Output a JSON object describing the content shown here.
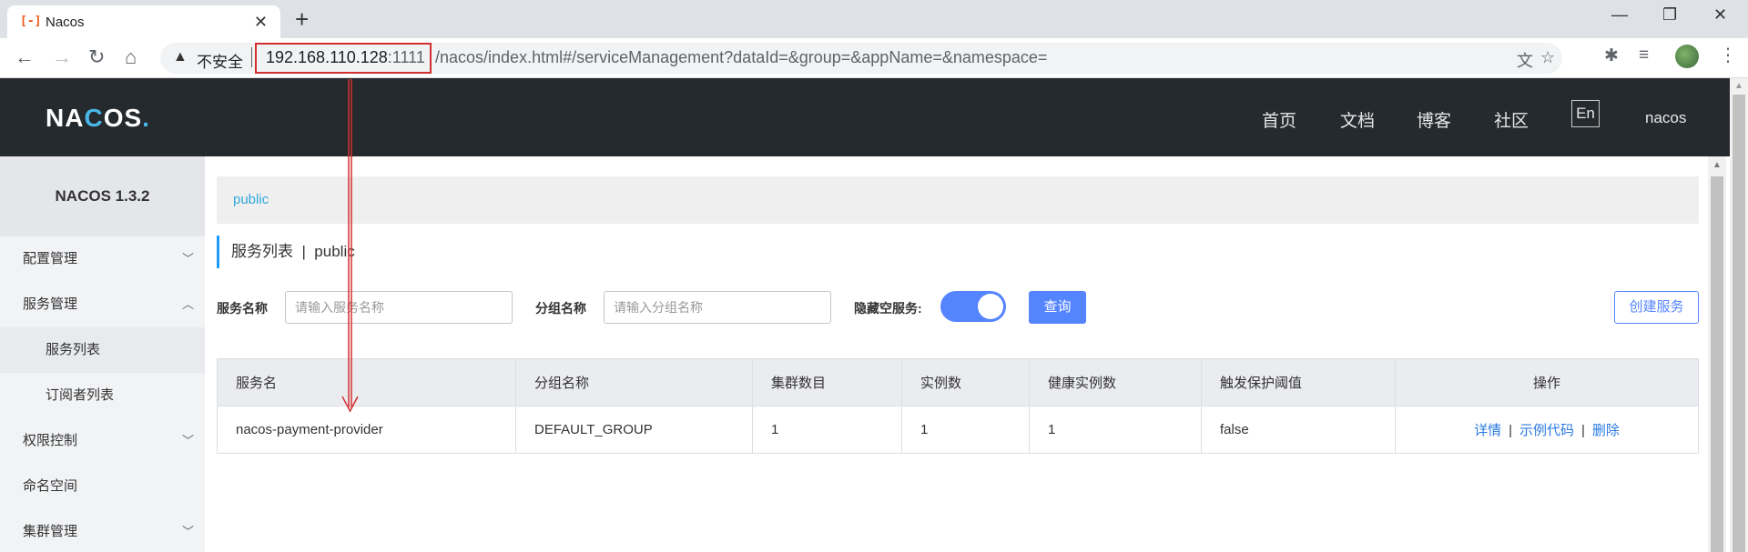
{
  "browser": {
    "tab_title": "Nacos",
    "tab_favicon": "[-]",
    "security_label": "不安全",
    "url_host": "192.168.110.128",
    "url_port": ":1111",
    "url_path": "/nacos/index.html#/serviceManagement?dataId=&group=&appName=&namespace="
  },
  "header": {
    "logo_text_1": "NA",
    "logo_text_2": "C",
    "logo_text_3": "OS",
    "logo_dot": ".",
    "nav": [
      "首页",
      "文档",
      "博客",
      "社区"
    ],
    "lang": "En",
    "user": "nacos"
  },
  "sidebar": {
    "title": "NACOS 1.3.2",
    "items": [
      {
        "label": "配置管理"
      },
      {
        "label": "服务管理"
      },
      {
        "label": "服务列表"
      },
      {
        "label": "订阅者列表"
      },
      {
        "label": "权限控制"
      },
      {
        "label": "命名空间"
      },
      {
        "label": "集群管理"
      }
    ]
  },
  "main": {
    "namespace": "public",
    "page_title": "服务列表  |  public",
    "filters": {
      "service_name_label": "服务名称",
      "service_name_placeholder": "请输入服务名称",
      "group_name_label": "分组名称",
      "group_name_placeholder": "请输入分组名称",
      "hide_empty_label": "隐藏空服务:",
      "query_button": "查询",
      "create_button": "创建服务"
    },
    "table": {
      "headers": [
        "服务名",
        "分组名称",
        "集群数目",
        "实例数",
        "健康实例数",
        "触发保护阈值",
        "操作"
      ],
      "rows": [
        {
          "service": "nacos-payment-provider",
          "group": "DEFAULT_GROUP",
          "clusters": "1",
          "instances": "1",
          "healthy": "1",
          "threshold": "false",
          "op_detail": "详情",
          "op_sample": "示例代码",
          "op_delete": "删除"
        }
      ]
    }
  },
  "colors": {
    "header_bg": "#252a2f",
    "accent_blue": "#5584ff",
    "link_blue": "#2a7ae2",
    "annotation_red": "#d32f2f"
  }
}
